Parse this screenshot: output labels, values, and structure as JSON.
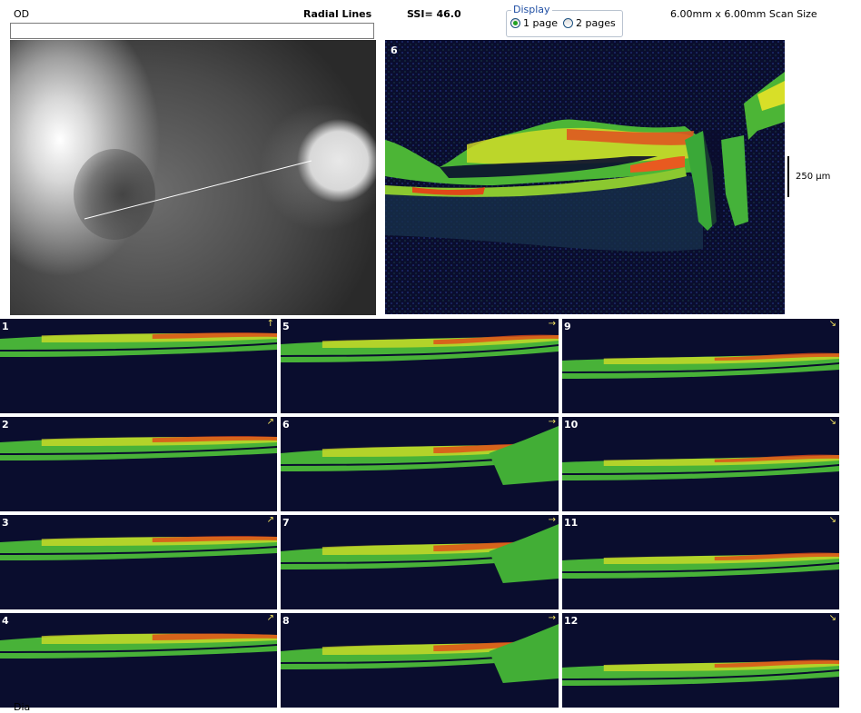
{
  "header": {
    "eye": "OD",
    "scan_pattern": "Radial Lines",
    "ssi": "SSI= 46.0",
    "scan_size": "6.00mm x 6.00mm Scan Size"
  },
  "display": {
    "legend": "Display",
    "options": [
      {
        "label": "1 page",
        "checked": true
      },
      {
        "label": "2 pages",
        "checked": false
      }
    ]
  },
  "comment": {
    "value": ""
  },
  "main_scan": {
    "number": "6",
    "scale_label": "250 µm"
  },
  "thumbnails": [
    {
      "number": "1",
      "arrow": "↑"
    },
    {
      "number": "2",
      "arrow": "↗"
    },
    {
      "number": "3",
      "arrow": "↗"
    },
    {
      "number": "4",
      "arrow": "↗"
    },
    {
      "number": "5",
      "arrow": "→"
    },
    {
      "number": "6",
      "arrow": "→"
    },
    {
      "number": "7",
      "arrow": "→"
    },
    {
      "number": "8",
      "arrow": "→"
    },
    {
      "number": "9",
      "arrow": "↘"
    },
    {
      "number": "10",
      "arrow": "↘"
    },
    {
      "number": "11",
      "arrow": "↘"
    },
    {
      "number": "12",
      "arrow": "↘"
    }
  ],
  "colors": {
    "oct_background": "#0a0d2e",
    "retina_green": "#3fb43a",
    "retina_yellow": "#d8e020",
    "retina_red": "#e04818",
    "display_legend": "#1f4ea3"
  },
  "footer": {
    "label": "Dia"
  }
}
